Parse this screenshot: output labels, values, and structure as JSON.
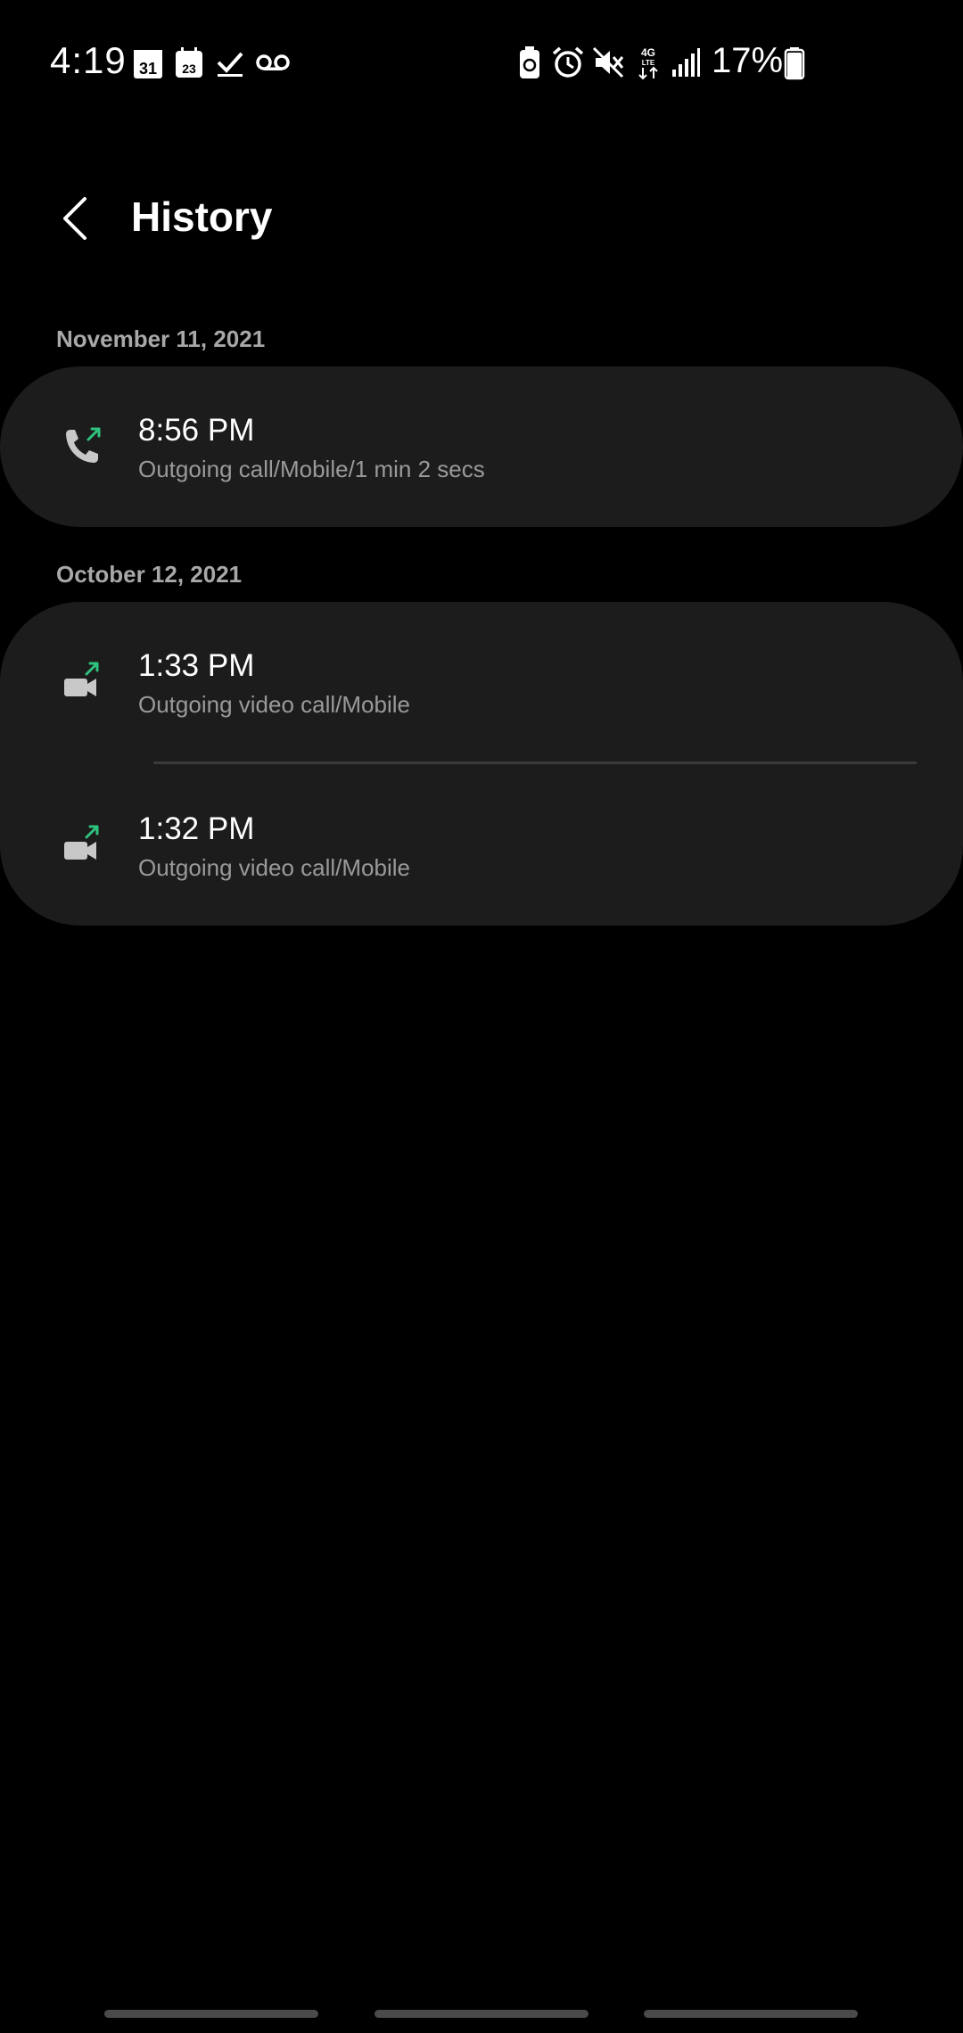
{
  "status_bar": {
    "time": "4:19",
    "battery_percent": "17%",
    "icons": [
      "calendar-31-icon",
      "calendar-23-icon",
      "task-check-icon",
      "voicemail-icon",
      "recycle-battery-icon",
      "alarm-icon",
      "mute-icon",
      "4g-lte-icon",
      "signal-icon",
      "battery-icon"
    ]
  },
  "header": {
    "title": "History"
  },
  "sections": [
    {
      "date": "November 11, 2021",
      "entries": [
        {
          "time": "8:56 PM",
          "detail": "Outgoing call/Mobile/1 min 2 secs",
          "icon": "outgoing-call-icon"
        }
      ]
    },
    {
      "date": "October 12, 2021",
      "entries": [
        {
          "time": "1:33 PM",
          "detail": "Outgoing video call/Mobile",
          "icon": "outgoing-video-call-icon"
        },
        {
          "time": "1:32 PM",
          "detail": "Outgoing video call/Mobile",
          "icon": "outgoing-video-call-icon"
        }
      ]
    }
  ],
  "colors": {
    "background": "#000000",
    "card": "#1c1c1c",
    "accent_green": "#2ec27e",
    "icon_gray": "#c8c8c8"
  }
}
